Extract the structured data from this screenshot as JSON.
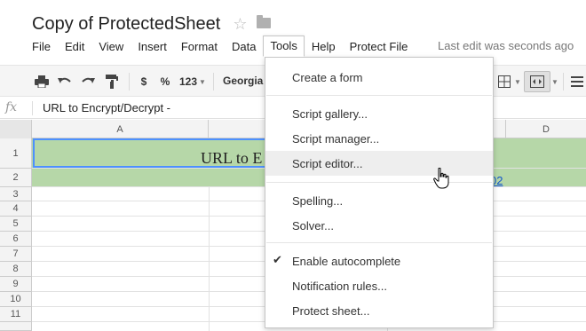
{
  "document": {
    "title": "Copy of ProtectedSheet",
    "last_edit": "Last edit was seconds ago"
  },
  "menubar": {
    "items": [
      "File",
      "Edit",
      "View",
      "Insert",
      "Format",
      "Data",
      "Tools",
      "Help",
      "Protect File"
    ],
    "active": "Tools"
  },
  "toolbar": {
    "currency_label": "$",
    "percent_label": "%",
    "number_format_label": "123",
    "font_label": "Georgia"
  },
  "formula_bar": {
    "fx_label": "fx",
    "content": "URL to Encrypt/Decrypt -"
  },
  "grid": {
    "columns": [
      "A",
      "D"
    ],
    "rows": [
      "1",
      "2",
      "3",
      "4",
      "5",
      "6",
      "7",
      "8",
      "9",
      "10",
      "11"
    ],
    "cell_a1_visible": "URL to E",
    "cell_link_visible": "02"
  },
  "tools_menu": {
    "groups": [
      [
        {
          "label": "Create a form"
        }
      ],
      [
        {
          "label": "Script gallery..."
        },
        {
          "label": "Script manager..."
        },
        {
          "label": "Script editor...",
          "highlighted": true
        }
      ],
      [
        {
          "label": "Spelling..."
        },
        {
          "label": "Solver..."
        }
      ],
      [
        {
          "label": "Enable autocomplete",
          "checked": true
        },
        {
          "label": "Notification rules..."
        },
        {
          "label": "Protect sheet..."
        }
      ]
    ]
  },
  "colors": {
    "header_green": "#b6d7a8",
    "selection_blue": "#4d90fe",
    "link_blue": "#1155cc",
    "toolbar_bg": "#f5f5f5"
  },
  "icons": {
    "star": "star-icon",
    "folder": "folder-icon",
    "print": "print-icon",
    "undo": "undo-icon",
    "redo": "redo-icon",
    "paint_format": "paint-format-icon",
    "borders": "borders-icon",
    "merge": "merge-cells-icon",
    "align": "align-icon",
    "cursor": "hand-cursor-icon"
  }
}
